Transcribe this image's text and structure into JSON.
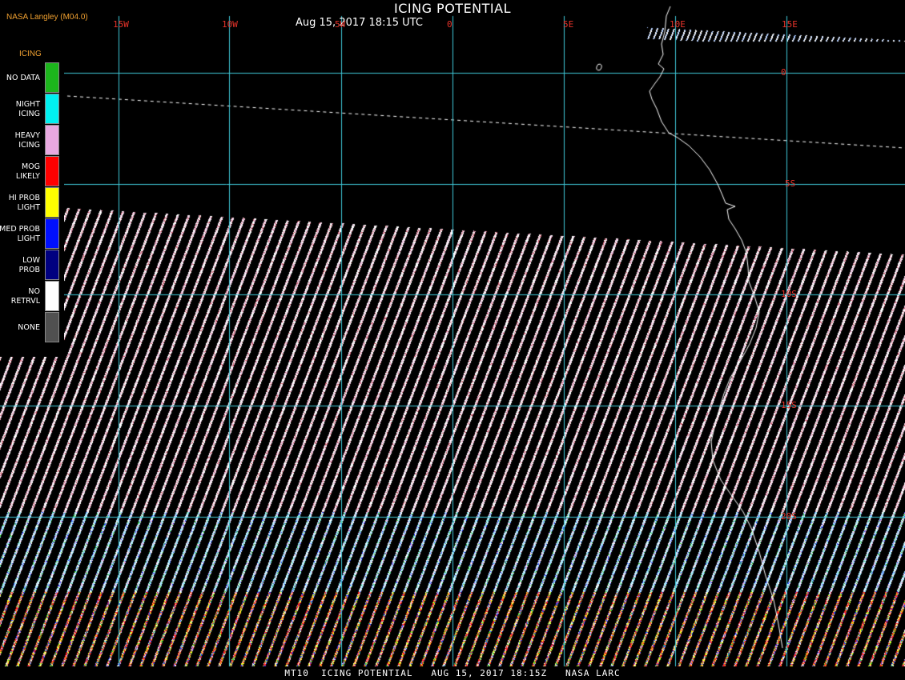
{
  "header": {
    "credit": "NASA Langley (M04.0)",
    "title": "ICING POTENTIAL",
    "timestamp": "Aug 15, 2017 18:15 UTC"
  },
  "legend": {
    "title": "ICING",
    "items": [
      {
        "label": "NO DATA",
        "color": "#1cb51c"
      },
      {
        "label": "NIGHT\nICING",
        "color": "#00f0f0"
      },
      {
        "label": "HEAVY\nICING",
        "color": "#e8a8e0"
      },
      {
        "label": "MOG\nLIKELY",
        "color": "#ff0000"
      },
      {
        "label": "HI PROB\nLIGHT",
        "color": "#ffff00"
      },
      {
        "label": "MED PROB\nLIGHT",
        "color": "#0010ff"
      },
      {
        "label": "LOW\nPROB",
        "color": "#000080"
      },
      {
        "label": "NO\nRETRVL",
        "color": "#ffffff"
      },
      {
        "label": "NONE",
        "color": "#505050"
      }
    ]
  },
  "map": {
    "longitude_labels": [
      "15W",
      "10W",
      "5W",
      "0",
      "5E",
      "10E",
      "15E"
    ],
    "latitude_labels": [
      "0",
      "5S",
      "10S",
      "15S",
      "20S"
    ],
    "grid_color": "#3fc8d8",
    "label_color": "#e8332a",
    "coastline_color": "#ffffff"
  },
  "footer": {
    "text": "MT10  ICING POTENTIAL   AUG 15, 2017 18:15Z   NASA LARC"
  }
}
